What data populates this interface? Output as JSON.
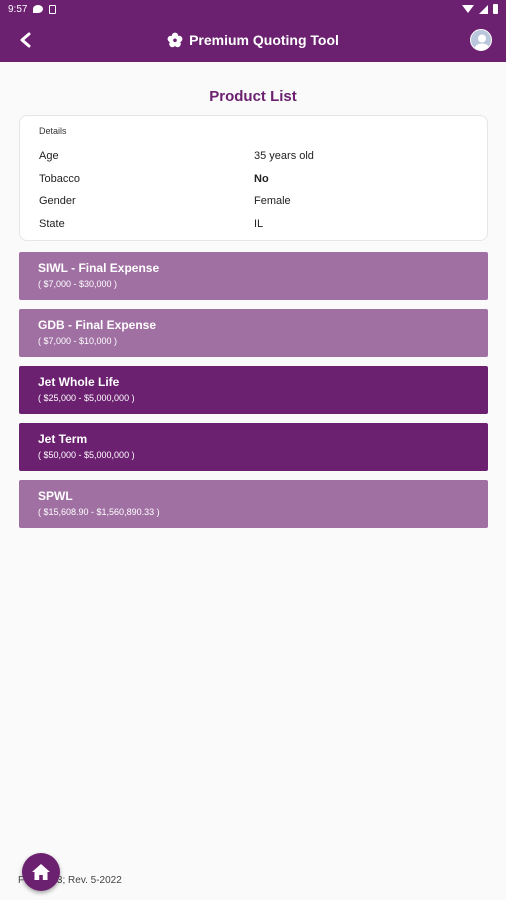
{
  "status_bar": {
    "time": "9:57"
  },
  "app_bar": {
    "title": "Premium Quoting Tool"
  },
  "page": {
    "heading": "Product List"
  },
  "details": {
    "label": "Details",
    "rows": [
      {
        "key": "Age",
        "value": "35 years old"
      },
      {
        "key": "Tobacco",
        "value": "No"
      },
      {
        "key": "Gender",
        "value": "Female"
      },
      {
        "key": "State",
        "value": "IL"
      }
    ]
  },
  "products": [
    {
      "name": "SIWL - Final Expense",
      "range": "( $7,000 - $30,000 )",
      "style": "light"
    },
    {
      "name": "GDB - Final Expense",
      "range": "( $7,000 - $10,000 )",
      "style": "light"
    },
    {
      "name": "Jet Whole Life",
      "range": "( $25,000 - $5,000,000 )",
      "style": "dark"
    },
    {
      "name": "Jet Term",
      "range": "( $50,000 - $5,000,000 )",
      "style": "dark"
    },
    {
      "name": "SPWL",
      "range": "( $15,608.90 - $1,560,890.33 )",
      "style": "light"
    }
  ],
  "footer": {
    "text": "F  Q00003; Rev. 5-2022"
  },
  "colors": {
    "primary": "#6b2070",
    "light": "#a070a3"
  },
  "icons": [
    "back-arrow-icon",
    "flower-logo-icon",
    "profile-icon",
    "home-icon",
    "message-icon",
    "sim-icon",
    "wifi-icon",
    "signal-icon",
    "battery-icon"
  ]
}
